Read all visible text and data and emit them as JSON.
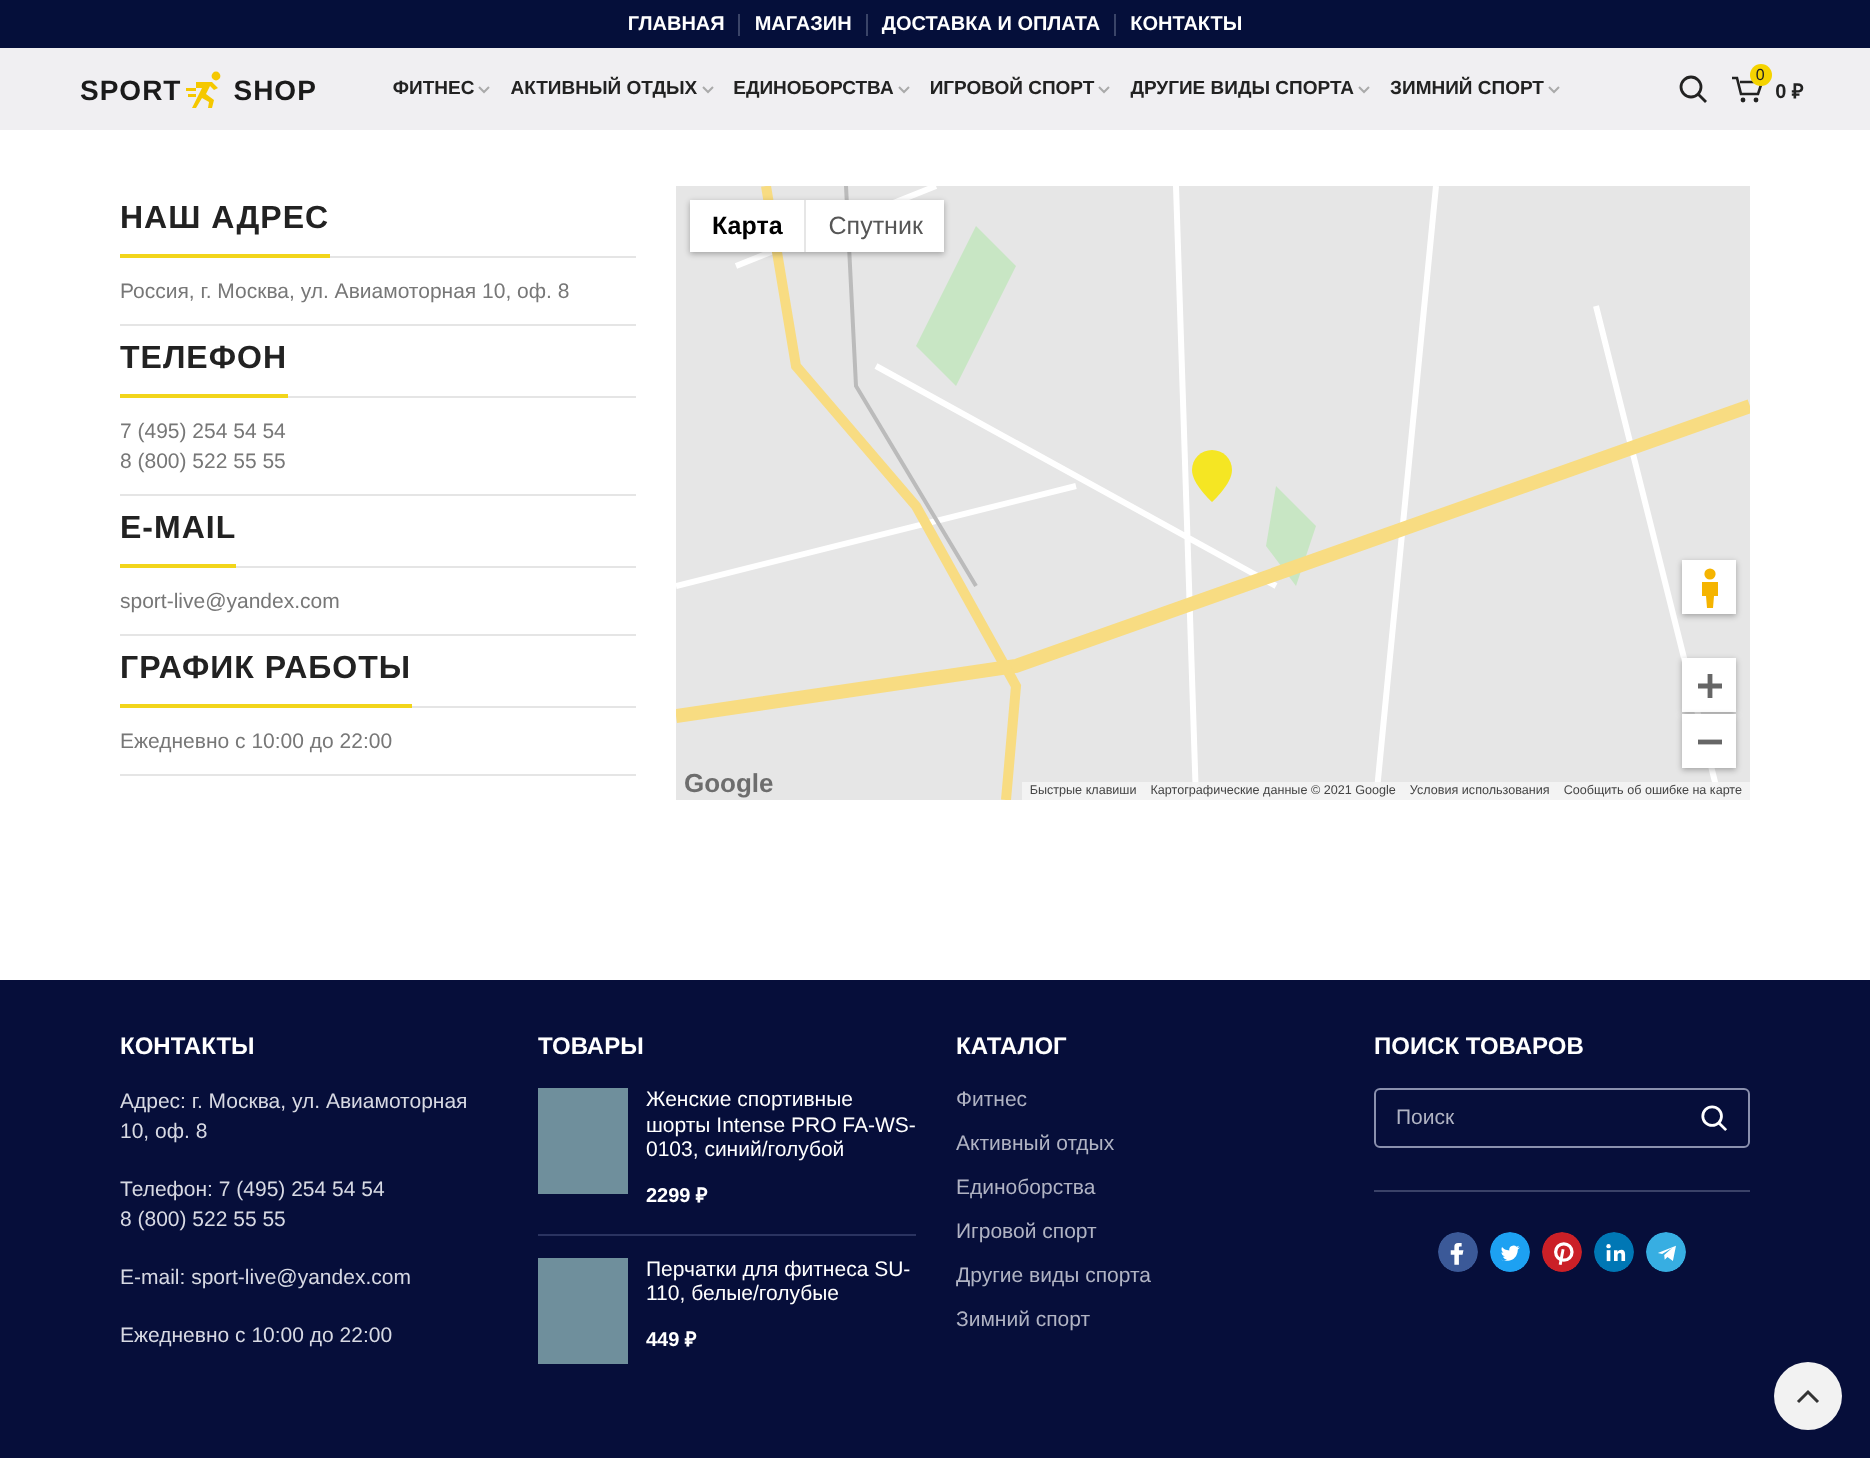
{
  "top_nav": [
    {
      "label": "ГЛАВНАЯ"
    },
    {
      "label": "МАГАЗИН"
    },
    {
      "label": "ДОСТАВКА И ОПЛАТА"
    },
    {
      "label": "КОНТАКТЫ"
    }
  ],
  "header": {
    "logo_left": "SPORT",
    "logo_right": "SHOP",
    "menu": [
      {
        "label": "ФИТНЕС"
      },
      {
        "label": "АКТИВНЫЙ ОТДЫХ"
      },
      {
        "label": "ЕДИНОБОРСТВА"
      },
      {
        "label": "ИГРОВОЙ СПОРТ"
      },
      {
        "label": "ДРУГИЕ ВИДЫ СПОРТА"
      },
      {
        "label": "ЗИМНИЙ СПОРТ"
      }
    ],
    "cart_count": "0",
    "cart_total": "0 ₽"
  },
  "contacts": [
    {
      "title": "НАШ АДРЕС",
      "lines": [
        "Россия, г. Москва, ул. Авиамоторная 10, оф. 8"
      ]
    },
    {
      "title": "ТЕЛЕФОН",
      "lines": [
        "7 (495) 254 54 54",
        "8 (800) 522 55 55"
      ]
    },
    {
      "title": "E-MAIL",
      "lines": [
        "sport-live@yandex.com"
      ]
    },
    {
      "title": "ГРАФИК РАБОТЫ",
      "lines": [
        "Ежедневно с 10:00 до 22:00"
      ]
    }
  ],
  "map": {
    "tabs": [
      {
        "label": "Карта",
        "selected": true
      },
      {
        "label": "Спутник",
        "selected": false
      }
    ],
    "logo": "Google",
    "attribution": [
      "Быстрые клавиши",
      "Картографические данные © 2021 Google",
      "Условия использования",
      "Сообщить об ошибке на карте"
    ]
  },
  "footer": {
    "contacts": {
      "title": "КОНТАКТЫ",
      "blocks": [
        [
          "Адрес: г. Москва, ул. Авиамоторная 10, оф. 8"
        ],
        [
          "Телефон: 7 (495) 254 54 54",
          "8 (800) 522 55 55"
        ],
        [
          "E-mail: sport-live@yandex.com"
        ],
        [
          "Ежедневно с 10:00 до 22:00"
        ]
      ]
    },
    "products": {
      "title": "ТОВАРЫ",
      "items": [
        {
          "name": "Женские спортивные шорты Intense PRO FA-WS-0103, синий/голубой",
          "price": "2299 ₽"
        },
        {
          "name": "Перчатки для фитнеса SU-110, белые/голубые",
          "price": "449 ₽"
        }
      ]
    },
    "catalog": {
      "title": "КАТАЛОГ",
      "links": [
        "Фитнес",
        "Активный отдых",
        "Единоборства",
        "Игровой спорт",
        "Другие виды спорта",
        "Зимний спорт"
      ]
    },
    "search": {
      "title": "ПОИСК ТОВАРОВ",
      "placeholder": "Поиск"
    },
    "socials": [
      {
        "color": "#3b5998"
      },
      {
        "color": "#1da1f2"
      },
      {
        "color": "#cb2027"
      },
      {
        "color": "#0077b5"
      },
      {
        "color": "#37aee2"
      }
    ]
  }
}
